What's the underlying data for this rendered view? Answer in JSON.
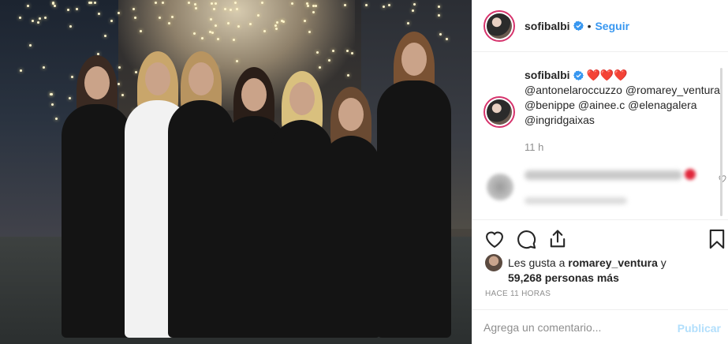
{
  "post": {
    "username": "sofibalbi",
    "follow_label": "Seguir",
    "dot": "•"
  },
  "caption": {
    "username": "sofibalbi",
    "hearts": "❤️❤️❤️",
    "mentions": "@antonelaroccuzzo @romarey_ventura @benippe @ainee.c @elenagalera @ingridgaixas",
    "time": "11 h"
  },
  "likes": {
    "prefix": "Les gusta a",
    "user": "romarey_ventura",
    "conj": "y",
    "count": "59,268 personas más"
  },
  "timestamp": "HACE 11 HORAS",
  "comment_box": {
    "placeholder": "Agrega un comentario...",
    "publish_label": "Publicar"
  },
  "icons": {
    "like": "heart-icon",
    "comment": "comment-icon",
    "share": "share-icon",
    "save": "bookmark-icon",
    "verified": "verified-badge-icon"
  },
  "colors": {
    "link": "#3897f0",
    "publish_disabled": "#b2dffc",
    "heart": "#e0263a",
    "muted": "#8e8e8e"
  }
}
